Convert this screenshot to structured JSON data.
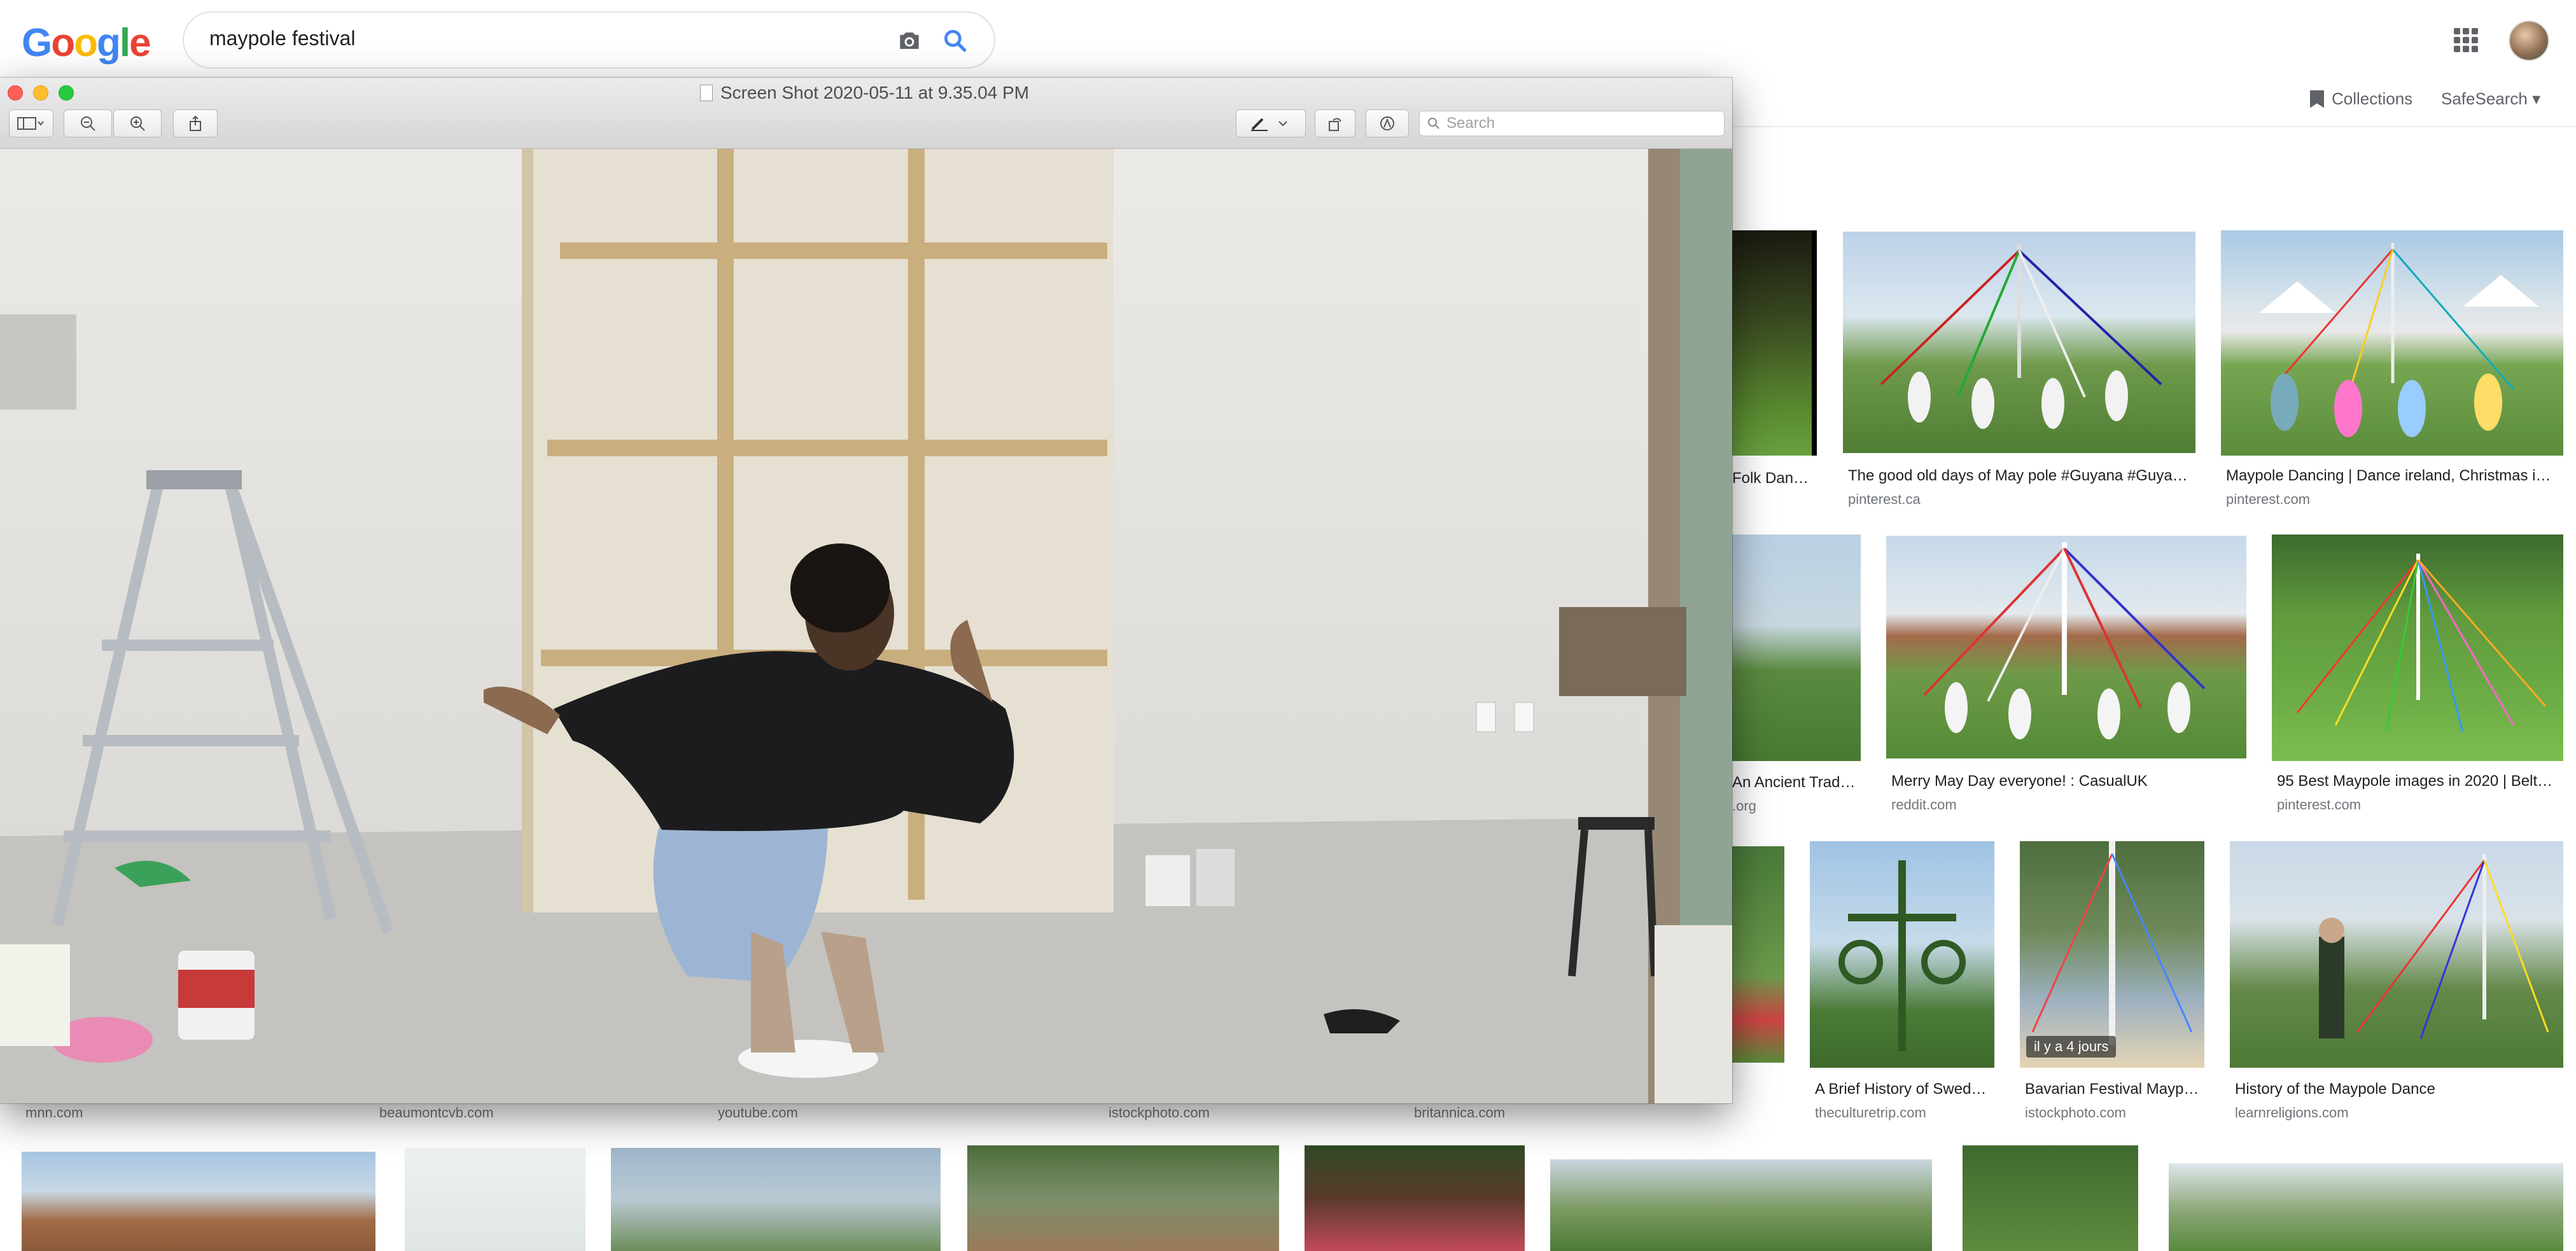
{
  "google": {
    "logo": [
      "G",
      "o",
      "o",
      "g",
      "l",
      "e"
    ],
    "logo_colors": [
      "#4285f4",
      "#ea4335",
      "#fbbc05",
      "#4285f4",
      "#34a853",
      "#ea4335"
    ],
    "search_query": "maypole festival",
    "collections_label": "Collections",
    "safesearch_label": "SafeSearch ▾"
  },
  "preview": {
    "title": "Screen Shot 2020-05-11 at 9.35.04 PM",
    "search_placeholder": "Search"
  },
  "results": {
    "row1": [
      {
        "caption": "Folk Dan…",
        "source": ""
      },
      {
        "caption": "The good old days of May pole #Guyana #Guya…",
        "source": "pinterest.ca"
      },
      {
        "caption": "Maypole Dancing | Dance ireland, Christmas i…",
        "source": "pinterest.com"
      }
    ],
    "row2": [
      {
        "caption": "An Ancient Trad…",
        "source": ".org"
      },
      {
        "caption": "Merry May Day everyone! : CasualUK",
        "source": "reddit.com"
      },
      {
        "caption": "95 Best Maypole images in 2020 | Belt…",
        "source": "pinterest.com"
      }
    ],
    "row3": [
      {
        "caption": "A Brief History of Swed…",
        "source": "theculturetrip.com"
      },
      {
        "caption": "Bavarian Festival Mayp…",
        "source": "istockphoto.com",
        "badge": "il y a 4 jours"
      },
      {
        "caption": "History of the Maypole Dance",
        "source": "learnreligions.com"
      }
    ],
    "row3_left_sources": [
      "mnn.com",
      "beaumontcvb.com",
      "youtube.com",
      "istockphoto.com",
      "britannica.com"
    ]
  }
}
